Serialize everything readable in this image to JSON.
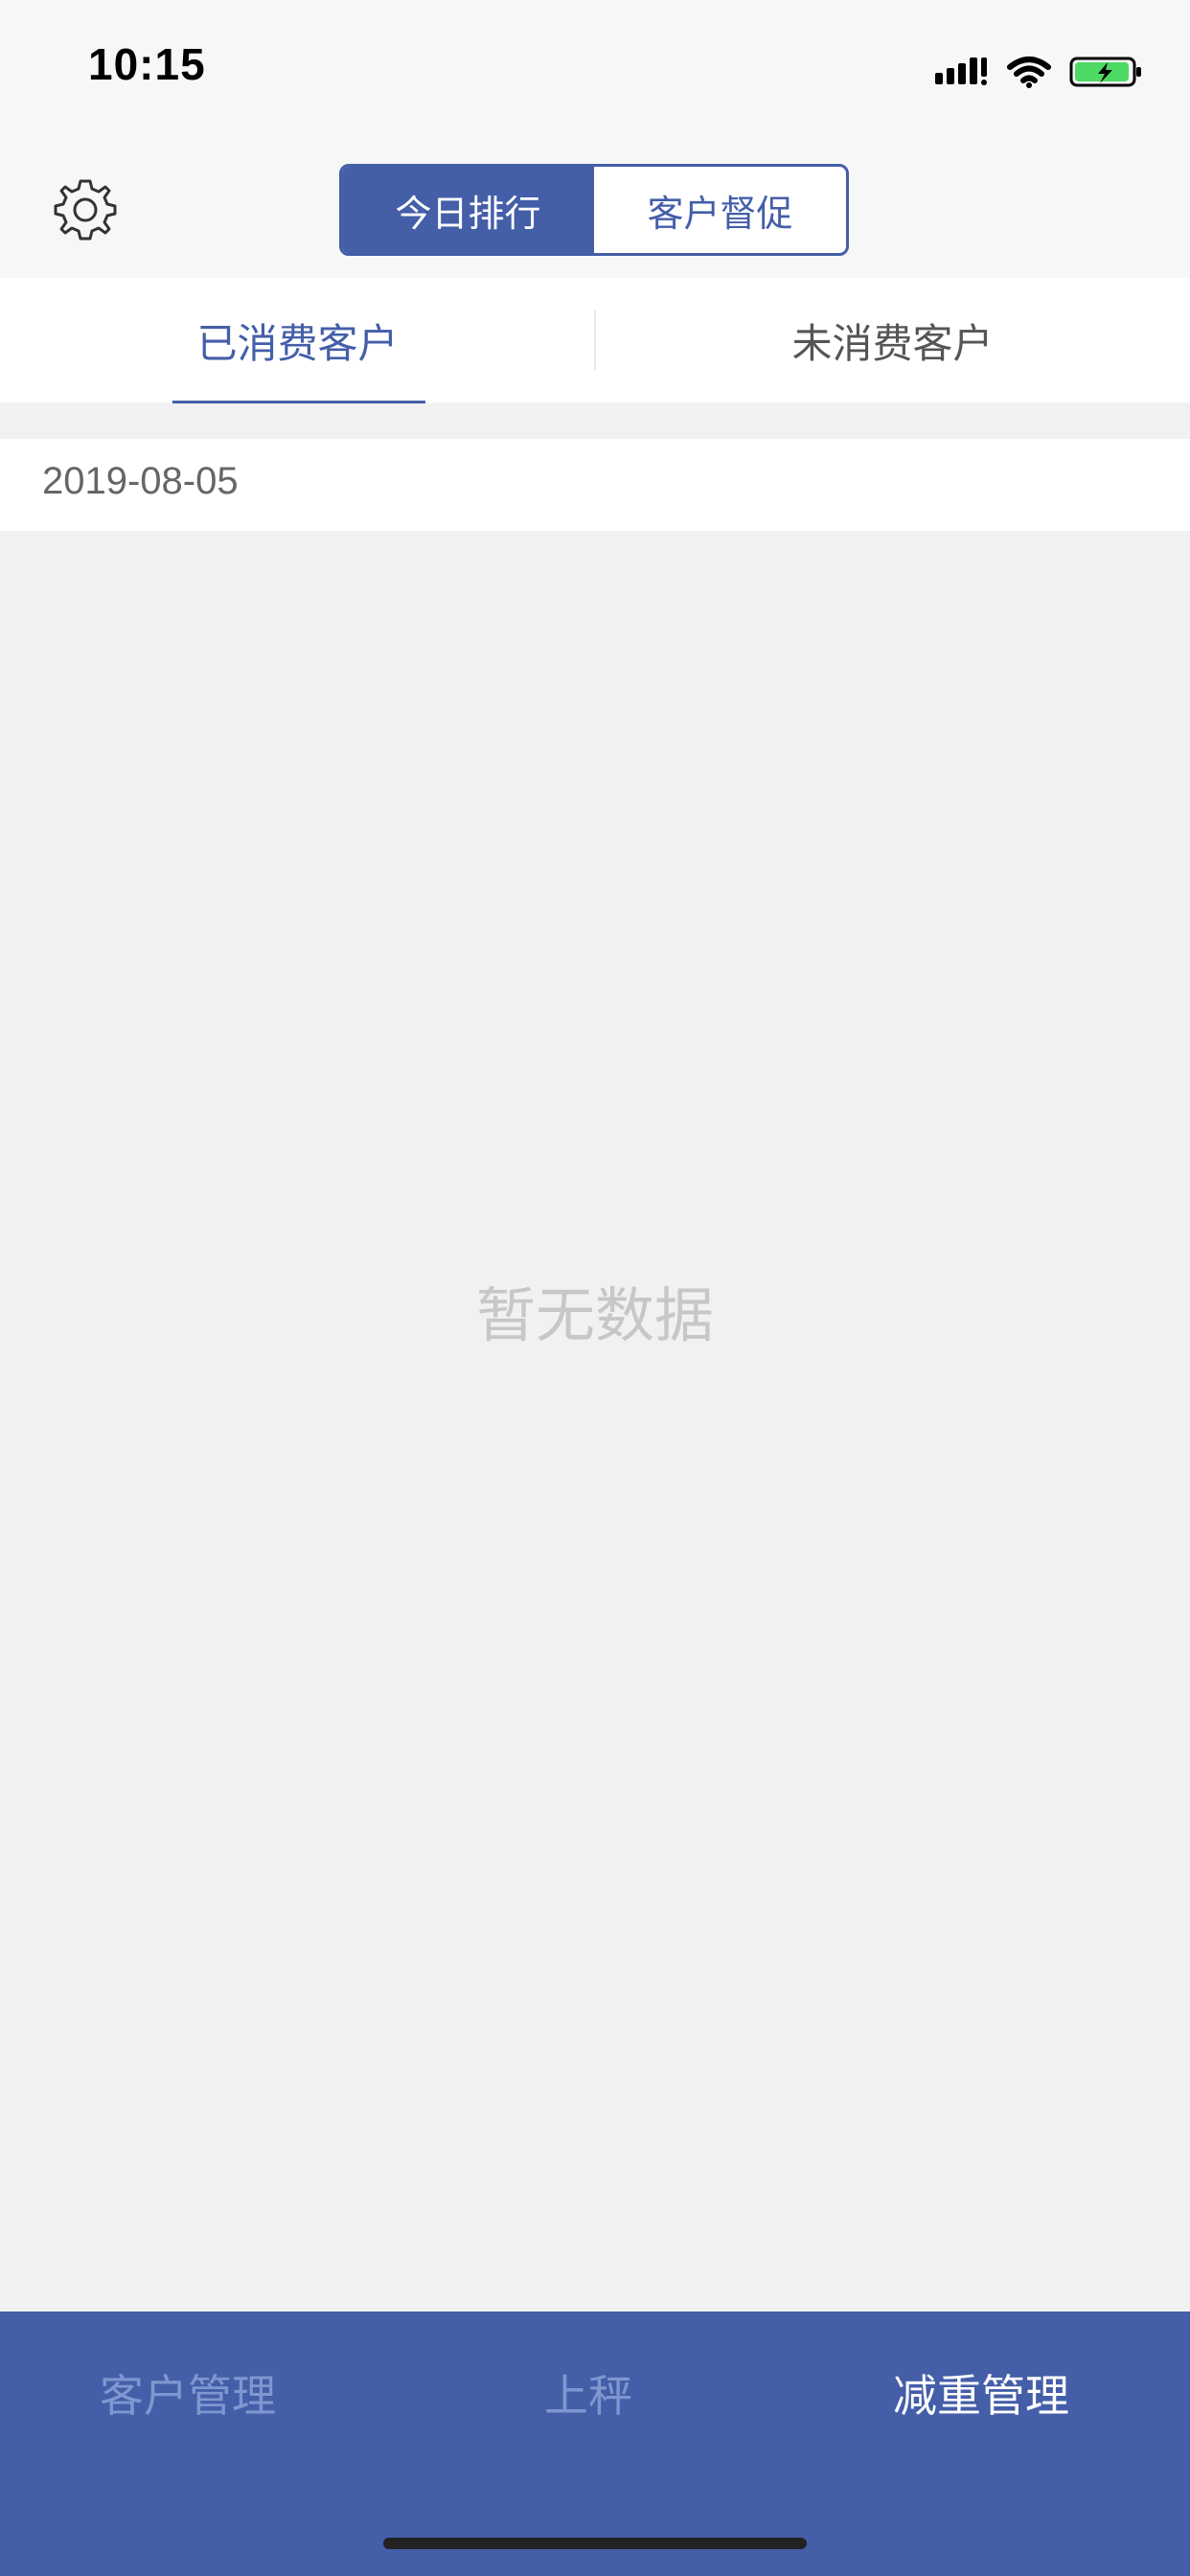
{
  "status_bar": {
    "time": "10:15"
  },
  "header": {
    "segments": [
      {
        "label": "今日排行",
        "active": true
      },
      {
        "label": "客户督促",
        "active": false
      }
    ]
  },
  "tabs": [
    {
      "label": "已消费客户",
      "active": true
    },
    {
      "label": "未消费客户",
      "active": false
    }
  ],
  "date": "2019-08-05",
  "empty_state": "暂无数据",
  "bottom_nav": [
    {
      "label": "客户管理",
      "active": false
    },
    {
      "label": "上秤",
      "active": false
    },
    {
      "label": "减重管理",
      "active": true
    }
  ],
  "colors": {
    "primary": "#445ea8",
    "background": "#f1f1f1",
    "inactive_nav": "#7f97d0",
    "empty_text": "#c7c7c7"
  }
}
